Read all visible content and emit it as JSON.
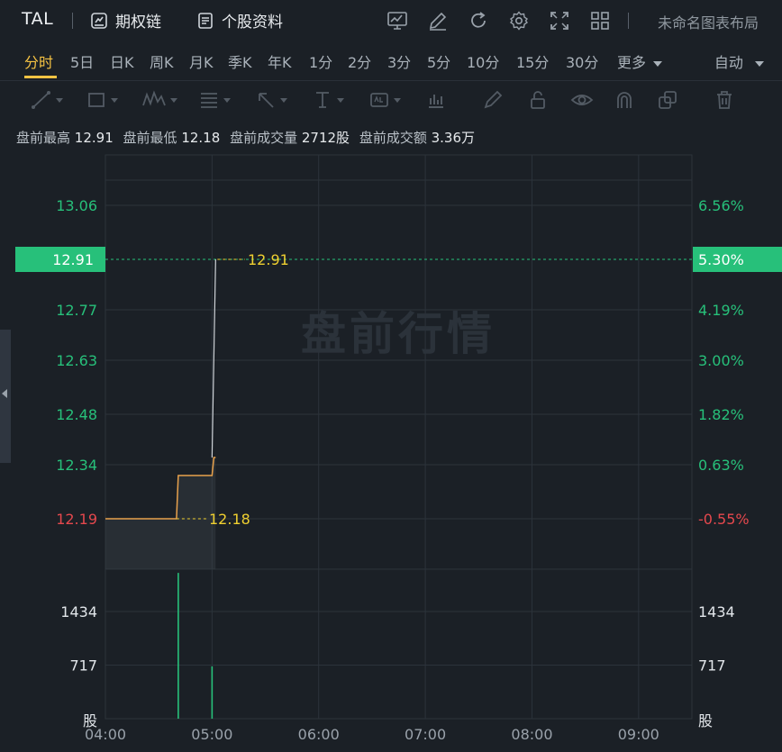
{
  "header": {
    "ticker": "TAL",
    "options_chain": "期权链",
    "profile": "个股资料",
    "layout_name": "未命名图表布局",
    "tools": [
      "chart-indicator-icon",
      "edit-icon",
      "refresh-icon",
      "settings-icon",
      "fullscreen-icon",
      "grid-layout-icon"
    ]
  },
  "periods": {
    "items": [
      "分时",
      "5日",
      "日K",
      "周K",
      "月K",
      "季K",
      "年K",
      "1分",
      "2分",
      "3分",
      "5分",
      "10分",
      "15分",
      "30分",
      "更多"
    ],
    "active": "分时",
    "auto_label": "自动"
  },
  "stats": {
    "high_label": "盘前最高",
    "high_value": "12.91",
    "low_label": "盘前最低",
    "low_value": "12.18",
    "volume_label": "盘前成交量",
    "volume_value": "2712股",
    "amount_label": "盘前成交额",
    "amount_value": "3.36万"
  },
  "chart_data": {
    "type": "line",
    "watermark": "盘前行情",
    "x_ticks": [
      "04:00",
      "05:00",
      "06:00",
      "07:00",
      "08:00",
      "09:00"
    ],
    "price_ticks": [
      {
        "price": "13.06",
        "pct": "6.56%",
        "v": 13.06
      },
      {
        "price": "12.77",
        "pct": "4.19%",
        "v": 12.77
      },
      {
        "price": "12.63",
        "pct": "3.00%",
        "v": 12.63
      },
      {
        "price": "12.48",
        "pct": "1.82%",
        "v": 12.48
      },
      {
        "price": "12.34",
        "pct": "0.63%",
        "v": 12.34
      },
      {
        "price": "12.19",
        "pct": "-0.55%",
        "v": 12.19
      }
    ],
    "current": {
      "price": "12.91",
      "pct": "5.30%",
      "v": 12.91
    },
    "high_marker": "12.91",
    "low_marker": "12.18",
    "ylim": [
      12.05,
      13.2
    ],
    "price_series": [
      {
        "t": 0,
        "v": 12.19
      },
      {
        "t": 40,
        "v": 12.19
      },
      {
        "t": 41,
        "v": 12.31
      },
      {
        "t": 60,
        "v": 12.31
      },
      {
        "t": 61,
        "v": 12.36
      },
      {
        "t": 62,
        "v": 12.36
      }
    ],
    "avg_series": [
      {
        "t": 60,
        "v": 12.36
      },
      {
        "t": 61,
        "v": 12.91
      }
    ],
    "volume_ticks": [
      {
        "label": "1434",
        "v": 1434
      },
      {
        "label": "717",
        "v": 717
      }
    ],
    "volume_unit": "股",
    "volume_ylim": [
      0,
      2000
    ],
    "volume_bars": [
      {
        "t": 41,
        "v": 1950
      },
      {
        "t": 60,
        "v": 700
      }
    ],
    "x_minutes_max": 330,
    "colors": {
      "up": "#27c07a",
      "down": "#e5484d",
      "price_line": "#e8a14c",
      "marker": "#f0d030",
      "current_bg": "#27c07a",
      "grid": "#2c333b"
    }
  }
}
